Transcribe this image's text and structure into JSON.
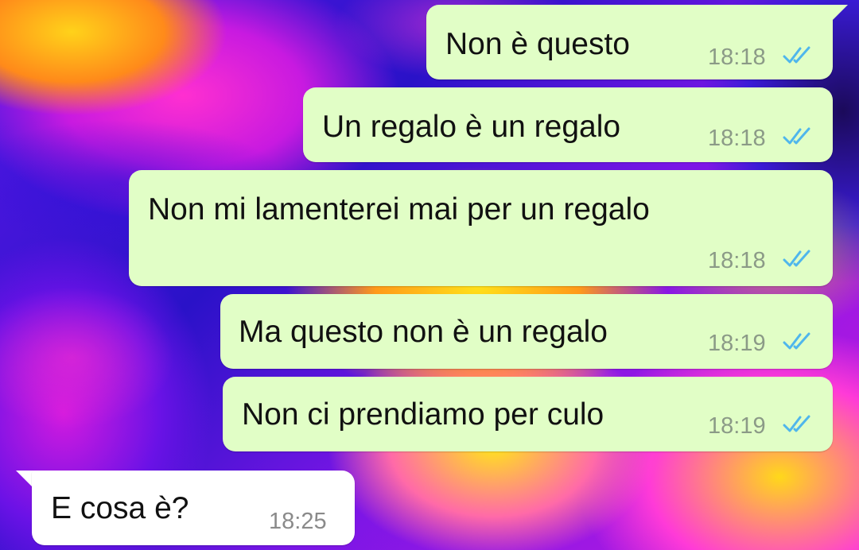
{
  "colors": {
    "outgoing_bubble": "#e1fec6",
    "incoming_bubble": "#ffffff",
    "read_tick": "#4fb6ec",
    "time_text": "#8b9a87"
  },
  "messages": [
    {
      "direction": "outgoing",
      "text": "Non è questo",
      "time": "18:18",
      "status": "read",
      "status_icon": "double-check-icon"
    },
    {
      "direction": "outgoing",
      "text": "Un regalo è un regalo",
      "time": "18:18",
      "status": "read",
      "status_icon": "double-check-icon"
    },
    {
      "direction": "outgoing",
      "text": "Non mi lamenterei mai per un regalo",
      "time": "18:18",
      "status": "read",
      "status_icon": "double-check-icon"
    },
    {
      "direction": "outgoing",
      "text": "Ma questo non è un regalo",
      "time": "18:19",
      "status": "read",
      "status_icon": "double-check-icon"
    },
    {
      "direction": "outgoing",
      "text": "Non ci prendiamo per culo",
      "time": "18:19",
      "status": "read",
      "status_icon": "double-check-icon"
    },
    {
      "direction": "incoming",
      "text": "E cosa è?",
      "time": "18:25"
    }
  ]
}
